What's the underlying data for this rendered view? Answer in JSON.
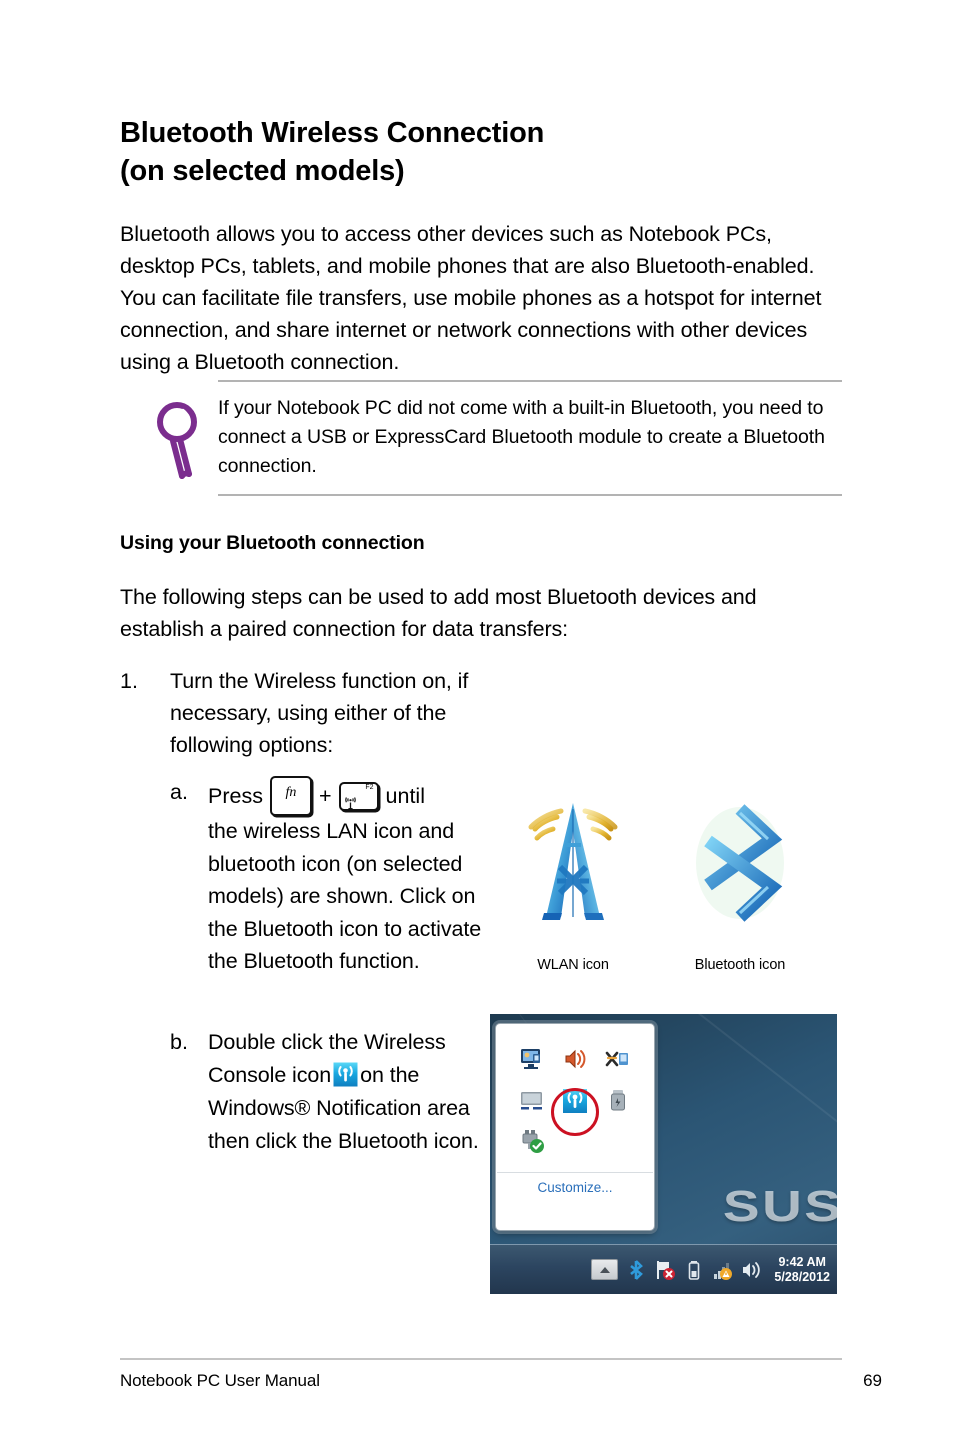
{
  "heading": {
    "line1": "Bluetooth Wireless Connection",
    "line2": "(on selected models)"
  },
  "intro": "Bluetooth allows you to access other devices such as Notebook PCs, desktop PCs, tablets, and mobile phones that are also Bluetooth-enabled. You can facilitate file transfers, use mobile phones as a hotspot for internet connection, and share internet or network connections with other devices using a Bluetooth connection.",
  "note": {
    "icon": "magnifier-icon",
    "icon_color": "#7B2D8E",
    "text": "If your Notebook PC did not come with a built-in Bluetooth, you need to connect a USB or ExpressCard Bluetooth module to create a Bluetooth connection."
  },
  "subheading": "Using your Bluetooth connection",
  "paragraph2": "The following steps can be used to add most Bluetooth devices and establish a paired connection for data transfers:",
  "steps": {
    "one": {
      "marker": "1.",
      "text": "Turn the Wireless function on, if necessary, using either of the following options:"
    },
    "a": {
      "marker": "a.",
      "press_label": "Press",
      "key_fn": "fn",
      "plus": "+",
      "key_f2_label": "F2",
      "until_label": "until",
      "body": "the wireless LAN icon and bluetooth icon (on selected models) are shown. Click on the Bluetooth icon to activate the Bluetooth function."
    },
    "b": {
      "marker": "b.",
      "text_before": "Double click the Wireless Console icon",
      "text_after": "on the Windows® Notification area then click the Bluetooth icon."
    }
  },
  "figure_icons": {
    "wlan_caption": "WLAN icon",
    "bluetooth_caption": "Bluetooth icon"
  },
  "screenshot": {
    "desktop_watermark": "SUS",
    "tray_popup": {
      "customize_label": "Customize...",
      "icons": [
        "network-monitor-icon",
        "volume-speaker-icon",
        "network-disconnected-icon",
        "display-monitor-icon",
        "wireless-console-icon",
        "usb-device-icon",
        "safely-remove-hardware-icon"
      ],
      "highlighted_icon": "wireless-console-icon"
    },
    "taskbar": {
      "show_hidden_icons": "show-hidden-icons-arrow",
      "icons": [
        "bluetooth-icon",
        "action-center-flag-error-icon",
        "battery-icon",
        "network-signal-warning-icon",
        "volume-icon"
      ],
      "time": "9:42 AM",
      "date": "5/28/2012"
    }
  },
  "footer": {
    "left": "Notebook PC User Manual",
    "page": "69"
  },
  "colors": {
    "note_accent": "#7B2D8E",
    "highlight_ring": "#CC1122",
    "link": "#2A6FBA",
    "desktop": "#2B5574"
  }
}
